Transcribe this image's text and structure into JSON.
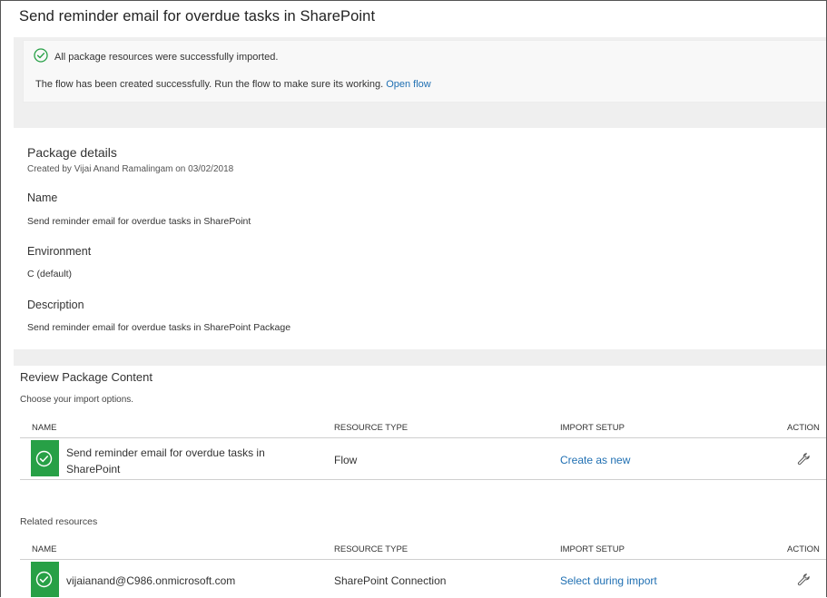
{
  "page": {
    "title": "Send reminder email for overdue tasks in SharePoint"
  },
  "status": {
    "import_message": "All package resources were successfully imported.",
    "flow_message": "The flow has been created successfully. Run the flow to make sure its working.",
    "open_flow_link": "Open flow"
  },
  "details": {
    "heading": "Package details",
    "created_by": "Created by Vijai Anand Ramalingam on 03/02/2018",
    "name_label": "Name",
    "name_value": "Send reminder email for overdue tasks in SharePoint",
    "environment_label": "Environment",
    "environment_value": "C (default)",
    "description_label": "Description",
    "description_value": "Send reminder email for overdue tasks in SharePoint Package"
  },
  "review": {
    "heading": "Review Package Content",
    "subheading": "Choose your import options.",
    "columns": {
      "name": "NAME",
      "resource_type": "RESOURCE TYPE",
      "import_setup": "IMPORT SETUP",
      "action": "ACTION"
    },
    "rows": [
      {
        "name_line1": "Send reminder email for overdue tasks in",
        "name_line2": "SharePoint",
        "resource_type": "Flow",
        "import_setup": "Create as new",
        "action_icon": "wrench-icon"
      }
    ]
  },
  "related": {
    "heading": "Related resources",
    "columns": {
      "name": "NAME",
      "resource_type": "RESOURCE TYPE",
      "import_setup": "IMPORT SETUP",
      "action": "ACTION"
    },
    "rows": [
      {
        "name": "vijaianand@C986.onmicrosoft.com",
        "resource_type": "SharePoint Connection",
        "import_setup": "Select during import",
        "action_icon": "wrench-icon"
      }
    ]
  },
  "colors": {
    "success_green": "#27a046",
    "link_blue": "#1f6fb2",
    "band_gray": "#efefef"
  }
}
